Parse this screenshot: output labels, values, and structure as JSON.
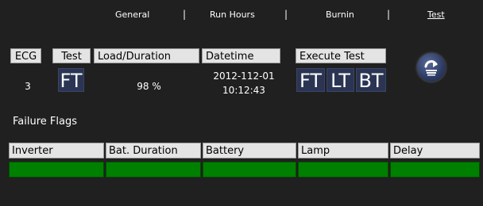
{
  "nav": {
    "tabs": [
      {
        "label": "General"
      },
      {
        "label": "Run Hours"
      },
      {
        "label": "Burnin"
      },
      {
        "label": "Test"
      }
    ],
    "active_tab": "Test",
    "separator": "|"
  },
  "test_panel": {
    "headers": {
      "ecg": "ECG",
      "test": "Test",
      "load_duration": "Load/Duration",
      "datetime": "Datetime",
      "execute_test": "Execute Test"
    },
    "row": {
      "ecg": "3",
      "test": "FT",
      "load_duration": "98 %",
      "date": "2012-112-01",
      "time": "10:12:43"
    },
    "execute_buttons": [
      "FT",
      "LT",
      "BT"
    ],
    "action_icon": "circular-arrow-return-icon"
  },
  "failure_flags": {
    "title": "Failure Flags",
    "columns": [
      "Inverter",
      "Bat. Duration",
      "Battery",
      "Lamp",
      "Delay"
    ],
    "status_color": "#008000"
  },
  "colors": {
    "background": "#202020",
    "header_bg": "#e4e4e4",
    "button_bg": "#2b3553",
    "ok_green": "#008000"
  }
}
